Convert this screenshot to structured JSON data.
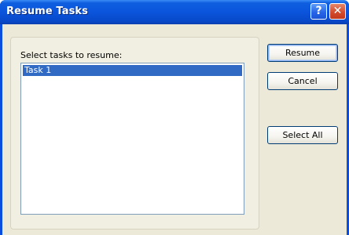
{
  "window": {
    "title": "Resume Tasks",
    "help_glyph": "?",
    "close_glyph": "✕"
  },
  "dialog": {
    "prompt": "Select tasks to resume:",
    "tasks": [
      {
        "label": "Task 1",
        "selected": true
      }
    ]
  },
  "buttons": {
    "resume": "Resume",
    "cancel": "Cancel",
    "select_all": "Select All"
  },
  "icons": {
    "help": "help-icon",
    "close": "close-icon"
  },
  "colors": {
    "title_bar": "#0a54dc",
    "selection": "#316ac5",
    "dialog_bg": "#ece9d8",
    "button_border": "#003c74"
  }
}
